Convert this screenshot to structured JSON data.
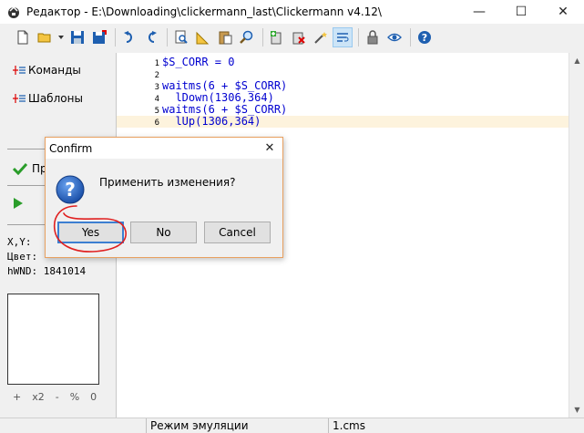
{
  "window": {
    "title": "Редактор - E:\\Downloading\\clickermann_last\\Clickermann v4.12\\",
    "minimize_glyph": "—",
    "maximize_glyph": "☐",
    "close_glyph": "✕"
  },
  "toolbar": {
    "buttons": [
      {
        "name": "new-file",
        "icon": "new-file-icon"
      },
      {
        "name": "open-file",
        "icon": "folder-open-icon"
      },
      {
        "name": "open-dropdown",
        "icon": "chevron-down-icon"
      },
      {
        "name": "save",
        "icon": "save-icon"
      },
      {
        "name": "save-as",
        "icon": "save-as-icon"
      },
      {
        "name": "undo",
        "icon": "undo-icon"
      },
      {
        "name": "redo",
        "icon": "redo-icon"
      },
      {
        "name": "find",
        "icon": "find-icon"
      },
      {
        "name": "ruler",
        "icon": "ruler-icon"
      },
      {
        "name": "paste",
        "icon": "paste-icon"
      },
      {
        "name": "search",
        "icon": "search-icon"
      },
      {
        "name": "add-script",
        "icon": "add-script-icon"
      },
      {
        "name": "delete-script",
        "icon": "delete-script-icon"
      },
      {
        "name": "wand",
        "icon": "wand-icon"
      },
      {
        "name": "wrap",
        "icon": "wrap-icon",
        "active": true
      },
      {
        "name": "lock",
        "icon": "lock-icon"
      },
      {
        "name": "view",
        "icon": "eye-icon"
      },
      {
        "name": "help",
        "icon": "help-icon"
      }
    ]
  },
  "sidebar": {
    "commands_label": "Команды",
    "templates_label": "Шаблоны",
    "apply_label": "Пр",
    "coords_label": "X,Y:",
    "color_label": "Цвет:",
    "hwnd_label": "hWND: 1841014",
    "zoom": [
      "+",
      "x2",
      "-",
      "%",
      "0"
    ]
  },
  "editor": {
    "lines": [
      {
        "n": "1",
        "text": "$S_CORR = 0"
      },
      {
        "n": "2",
        "text": ""
      },
      {
        "n": "3",
        "text": "waitms(6 + $S_CORR)"
      },
      {
        "n": "4",
        "text": "  lDown(1306,364)"
      },
      {
        "n": "5",
        "text": "waitms(6 + $S_CORR)"
      },
      {
        "n": "6",
        "text": "  lUp(1306,364)",
        "current": true
      }
    ]
  },
  "status": {
    "mode": "Режим эмуляции",
    "file": "1.cms"
  },
  "dialog": {
    "title": "Confirm",
    "close_glyph": "✕",
    "message": "Применить изменения?",
    "yes_label": "Yes",
    "no_label": "No",
    "cancel_label": "Cancel"
  },
  "colors": {
    "code_blue": "#0000d0",
    "current_line": "#fdf3dd",
    "dialog_border": "#e8a060",
    "default_button_border": "#3c7fd1",
    "annotation_red": "#e02020"
  }
}
